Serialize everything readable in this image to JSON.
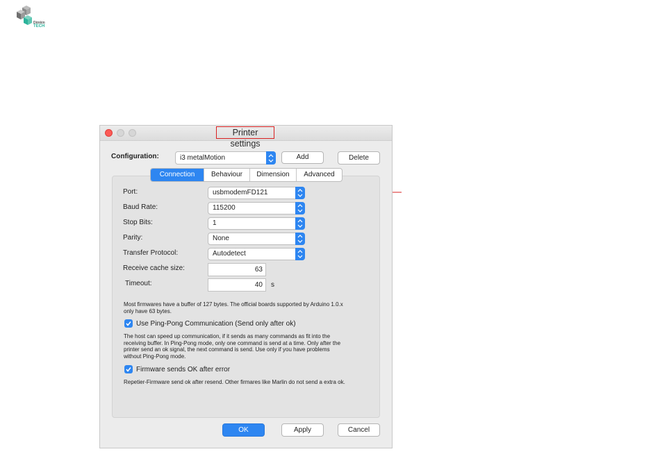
{
  "logo": {
    "brand_line1": "Dimkin",
    "brand_line2": "TECH"
  },
  "window": {
    "title": "Printer settings"
  },
  "configuration": {
    "label": "Configuration:",
    "selected": "i3 metalMotion",
    "add_label": "Add",
    "delete_label": "Delete"
  },
  "tabs": [
    {
      "label": "Connection",
      "active": true
    },
    {
      "label": "Behaviour",
      "active": false
    },
    {
      "label": "Dimension",
      "active": false
    },
    {
      "label": "Advanced",
      "active": false
    }
  ],
  "fields": {
    "port": {
      "label": "Port:",
      "value": "usbmodemFD121"
    },
    "baud_rate": {
      "label": "Baud Rate:",
      "value": "115200"
    },
    "stop_bits": {
      "label": "Stop Bits:",
      "value": "1"
    },
    "parity": {
      "label": "Parity:",
      "value": "None"
    },
    "transfer_protocol": {
      "label": "Transfer Protocol:",
      "value": "Autodetect"
    },
    "receive_cache": {
      "label": "Receive cache size:",
      "value": "63"
    },
    "timeout": {
      "label": "Timeout:",
      "value": "40",
      "unit": "s"
    }
  },
  "notes": {
    "buffer_line1": "Most firmwares have a buffer of 127 bytes. The official boards supported by Arduino 1.0.x",
    "buffer_line2": "only have 63 bytes.",
    "pingpong_label": "Use Ping-Pong Communication (Send only after ok)",
    "pingpong_line1": "The host can speed up communication, if it sends as many commands as fit into the",
    "pingpong_line2": "receiving buffer. In Ping-Pong mode, only one command is send at a time. Only after the",
    "pingpong_line3": "printer send an ok signal, the next command is send. Use only if you have problems",
    "pingpong_line4": "without Ping-Pong mode.",
    "firmware_ok_label": "Firmware sends OK after error",
    "firmware_ok_desc": "Repetier-Firmware send ok after resend. Other firmares like Marlin do not send a extra ok."
  },
  "footer": {
    "ok_label": "OK",
    "apply_label": "Apply",
    "cancel_label": "Cancel"
  },
  "colors": {
    "accent": "#2e86f1",
    "highlight_box": "#d92020",
    "arrow": "#d92020",
    "close": "#fc5b57"
  }
}
